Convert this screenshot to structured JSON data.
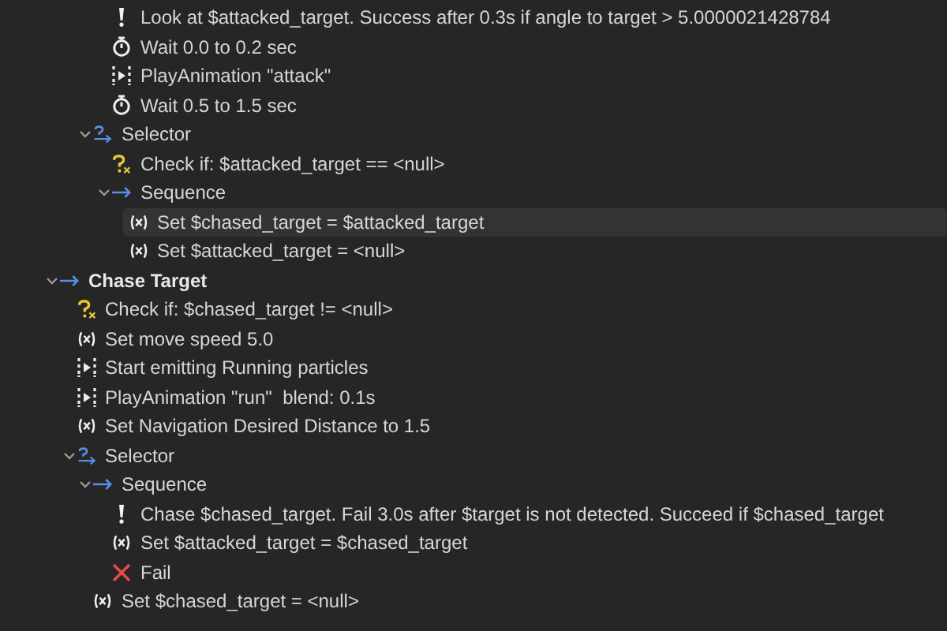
{
  "tree": [
    {
      "children": [
        {
          "children": [
            {
              "children": [
                {
                  "kind": "action",
                  "label": "Look at $attacked_target. Success after 0.3s if angle to target > 5.0000021428784",
                  "selected": false
                },
                {
                  "kind": "wait",
                  "label": "Wait 0.0 to 0.2 sec",
                  "selected": false
                },
                {
                  "kind": "animation",
                  "label": "PlayAnimation \"attack\"",
                  "selected": false
                },
                {
                  "kind": "wait",
                  "label": "Wait 0.5 to 1.5 sec",
                  "selected": false
                }
              ]
            },
            {
              "kind": "selector",
              "label": "Selector",
              "expanded": true,
              "selected": false,
              "children": [
                {
                  "kind": "condition",
                  "label": "Check if: $attacked_target == <null>",
                  "selected": false
                },
                {
                  "kind": "sequence",
                  "label": "Sequence",
                  "expanded": true,
                  "selected": false,
                  "children": [
                    {
                      "kind": "variable",
                      "label": "Set $chased_target = $attacked_target",
                      "selected": true
                    },
                    {
                      "kind": "variable",
                      "label": "Set $attacked_target = <null>",
                      "selected": false
                    }
                  ]
                }
              ]
            }
          ]
        }
      ]
    },
    {
      "kind": "sequence",
      "label": "Chase Target",
      "bold": true,
      "expanded": true,
      "selected": false,
      "children": [
        {
          "kind": "condition",
          "label": "Check if: $chased_target != <null>",
          "selected": false
        },
        {
          "kind": "variable",
          "label": "Set move speed 5.0",
          "selected": false
        },
        {
          "kind": "animation",
          "label": "Start emitting Running particles",
          "selected": false
        },
        {
          "kind": "animation",
          "label": "PlayAnimation \"run\"  blend: 0.1s",
          "selected": false
        },
        {
          "kind": "variable",
          "label": "Set Navigation Desired Distance to 1.5",
          "selected": false
        },
        {
          "kind": "selector",
          "label": "Selector",
          "expanded": true,
          "selected": false,
          "children": [
            {
              "kind": "sequence",
              "label": "Sequence",
              "expanded": true,
              "selected": false,
              "children": [
                {
                  "kind": "action",
                  "label": "Chase $chased_target. Fail 3.0s after $target is not detected. Succeed if $chased_target",
                  "selected": false
                },
                {
                  "kind": "variable",
                  "label": "Set $attacked_target = $chased_target",
                  "selected": false
                },
                {
                  "kind": "fail",
                  "label": "Fail",
                  "selected": false
                }
              ]
            },
            {
              "kind": "variable",
              "label": "Set $chased_target = <null>",
              "selected": false
            }
          ]
        }
      ]
    }
  ]
}
